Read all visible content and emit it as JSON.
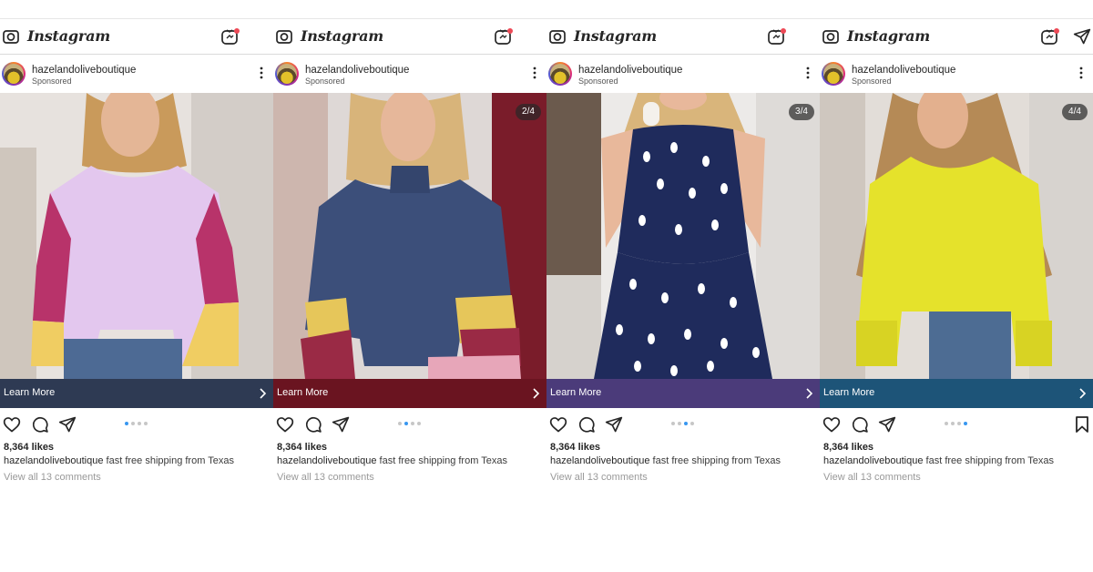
{
  "app": {
    "name": "Instagram"
  },
  "posts": [
    {
      "username": "hazelandoliveboutique",
      "sponsored": "Sponsored",
      "counter": "",
      "cta_label": "Learn More",
      "cta_color": "#2e3a53",
      "likes": "8,364 likes",
      "caption_user": "hazelandoliveboutique",
      "caption_text": "fast free shipping from Texas",
      "comments": "View all 13 comments",
      "active_index": 0,
      "image_desc": "lilac ribbed top with magenta, yellow and white colorblock sleeves"
    },
    {
      "username": "hazelandoliveboutique",
      "sponsored": "Sponsored",
      "counter": "2/4",
      "cta_label": "Learn More",
      "cta_color": "#6a1420",
      "likes": "8,364 likes",
      "caption_user": "hazelandoliveboutique",
      "caption_text": "fast free shipping from Texas",
      "comments": "View all 13 comments",
      "active_index": 1,
      "image_desc": "navy cowl neck top with ruffled colorblock sleeves"
    },
    {
      "username": "hazelandoliveboutique",
      "sponsored": "Sponsored",
      "counter": "3/4",
      "cta_label": "Learn More",
      "cta_color": "#4b3b7a",
      "likes": "8,364 likes",
      "caption_user": "hazelandoliveboutique",
      "caption_text": "fast free shipping from Texas",
      "comments": "View all 13 comments",
      "active_index": 2,
      "image_desc": "navy halter dress with white dots"
    },
    {
      "username": "hazelandoliveboutique",
      "sponsored": "Sponsored",
      "counter": "4/4",
      "cta_label": "Learn More",
      "cta_color": "#1d5478",
      "likes": "8,364 likes",
      "caption_user": "hazelandoliveboutique",
      "caption_text": "fast free shipping from Texas",
      "comments": "View all 13 comments",
      "active_index": 3,
      "image_desc": "yellow knit sweater"
    }
  ],
  "icons": {
    "camera": "camera-icon",
    "igtv": "igtv-icon",
    "direct": "send-icon",
    "more": "more-icon",
    "heart": "heart-icon",
    "comment": "comment-icon",
    "share": "share-icon",
    "bookmark": "bookmark-icon",
    "chevron": "chevron-right-icon"
  },
  "colors": {
    "dot_active": "#3897f0",
    "dot_inactive": "#c7c7c7",
    "igtv_badge": "#ed4956"
  }
}
